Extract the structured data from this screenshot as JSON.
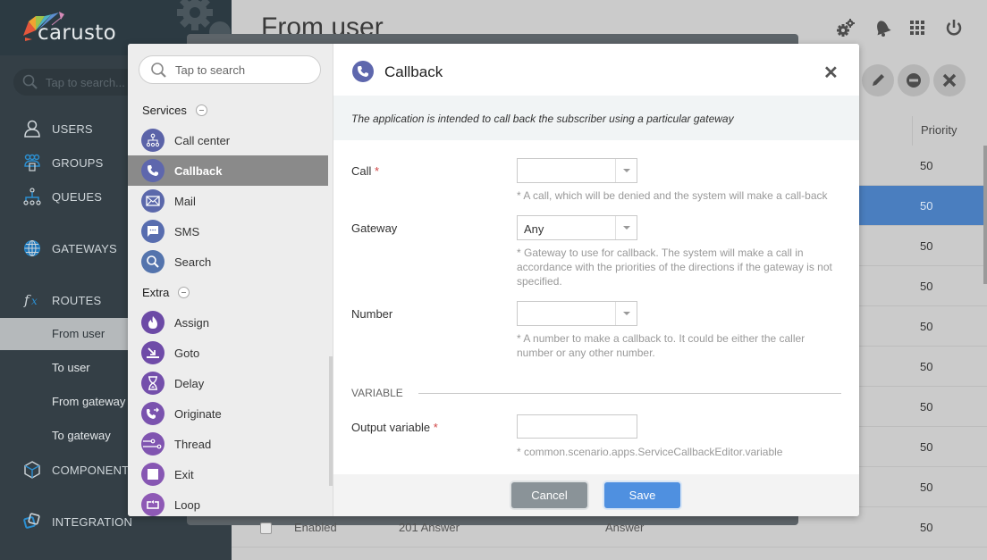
{
  "app": {
    "logo_text": "carusto",
    "sidebar_search_placeholder": "Tap to search...",
    "page_title": "From user"
  },
  "sidebar": {
    "items": [
      {
        "label": "USERS",
        "icon": "user-icon"
      },
      {
        "label": "GROUPS",
        "icon": "groups-icon"
      },
      {
        "label": "QUEUES",
        "icon": "queues-icon"
      },
      {
        "label": "GATEWAYS",
        "icon": "globe-icon"
      },
      {
        "label": "ROUTES",
        "icon": "function-icon"
      },
      {
        "label": "COMPONENTS",
        "icon": "cube-icon"
      },
      {
        "label": "INTEGRATION",
        "icon": "integration-icon"
      }
    ],
    "route_subitems": [
      {
        "label": "From user",
        "active": true
      },
      {
        "label": "To user",
        "active": false
      },
      {
        "label": "From gateway",
        "active": false
      },
      {
        "label": "To gateway",
        "active": false
      }
    ]
  },
  "topbar": {
    "icons": [
      "settings-icon",
      "bell-icon",
      "apps-grid-icon",
      "power-icon"
    ]
  },
  "toolbar": {
    "actions": [
      "edit-icon",
      "disable-icon",
      "delete-icon"
    ]
  },
  "table": {
    "columns": {
      "priority": "Priority"
    },
    "rows": [
      {
        "priority": "50",
        "selected": false
      },
      {
        "priority": "50",
        "selected": true
      },
      {
        "priority": "50",
        "selected": false
      },
      {
        "priority": "50",
        "selected": false
      },
      {
        "priority": "50",
        "selected": false
      },
      {
        "priority": "50",
        "selected": false
      },
      {
        "priority": "50",
        "selected": false
      },
      {
        "priority": "50",
        "selected": false
      },
      {
        "priority": "50",
        "selected": false
      }
    ],
    "bottom_row": {
      "status": "Enabled",
      "name": "201 Answer",
      "type": "Answer",
      "priority": "50"
    }
  },
  "palette": {
    "search_placeholder": "Tap to search",
    "groups": [
      {
        "label": "Services",
        "items": [
          {
            "label": "Call center",
            "icon": "call-center-icon",
            "color": "#5b63a8"
          },
          {
            "label": "Callback",
            "icon": "phone-icon",
            "color": "#5e67ad",
            "active": true
          },
          {
            "label": "Mail",
            "icon": "mail-icon",
            "color": "#5b68ab"
          },
          {
            "label": "SMS",
            "icon": "sms-icon",
            "color": "#586daf"
          },
          {
            "label": "Search",
            "icon": "search-icon",
            "color": "#5474ad"
          }
        ]
      },
      {
        "label": "Extra",
        "items": [
          {
            "label": "Assign",
            "icon": "flame-icon",
            "color": "#6c4aa6"
          },
          {
            "label": "Goto",
            "icon": "goto-icon",
            "color": "#6f4ba8"
          },
          {
            "label": "Delay",
            "icon": "hourglass-icon",
            "color": "#744fab"
          },
          {
            "label": "Originate",
            "icon": "originate-icon",
            "color": "#7a52ae"
          },
          {
            "label": "Thread",
            "icon": "thread-icon",
            "color": "#8054b0"
          },
          {
            "label": "Exit",
            "icon": "stop-icon",
            "color": "#8757b3"
          },
          {
            "label": "Loop",
            "icon": "loop-icon",
            "color": "#8e59b5"
          }
        ]
      }
    ]
  },
  "editor": {
    "title": "Callback",
    "close_label": "✕",
    "description": "The application is intended to call back the subscriber using a particular gateway",
    "fields": {
      "call": {
        "label": "Call",
        "required": "*",
        "value": "",
        "hint": "* A call, which will be denied and the system will make a call-back"
      },
      "gateway": {
        "label": "Gateway",
        "value": "Any",
        "hint": "* Gateway to use for callback. The system will make a call in accordance with the priorities of the directions if the gateway is not specified."
      },
      "number": {
        "label": "Number",
        "value": "",
        "hint": "* A number to make a callback to. It could be either the caller number or any other number."
      },
      "output_variable": {
        "label": "Output variable",
        "required": "*",
        "value": "",
        "hint": "* common.scenario.apps.ServiceCallbackEditor.variable"
      }
    },
    "section_variable": "VARIABLE",
    "cancel_label": "Cancel",
    "save_label": "Save"
  }
}
